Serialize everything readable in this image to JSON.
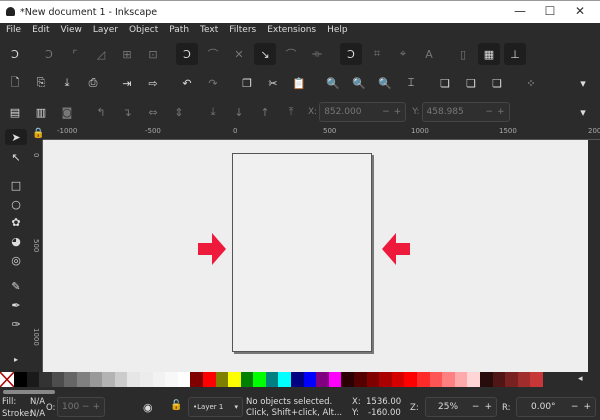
{
  "window": {
    "title": "*New document 1 - Inkscape",
    "minimize": "—",
    "maximize": "☐",
    "close": "✕"
  },
  "menu": [
    "File",
    "Edit",
    "View",
    "Layer",
    "Object",
    "Path",
    "Text",
    "Filters",
    "Extensions",
    "Help"
  ],
  "toolbar_snap": [
    "snap-toggle",
    "snap-bbox",
    "snap-bbox-edge",
    "snap-bbox-corner",
    "snap-bbox-midpoint",
    "snap-bbox-center",
    "snap-nodes",
    "snap-path",
    "snap-intersection",
    "snap-cusp",
    "snap-smooth",
    "snap-midpoint",
    "snap-others",
    "snap-center",
    "snap-rotation-center",
    "snap-text-baseline",
    "snap-page",
    "snap-grid",
    "snap-guide"
  ],
  "toolbar_commands": [
    "new",
    "open",
    "save",
    "print",
    "import",
    "export",
    "undo",
    "redo",
    "copy",
    "cut",
    "paste",
    "zoom-selection",
    "zoom-drawing",
    "zoom-page",
    "zoom-page-width",
    "duplicate",
    "clone",
    "unlink-clone",
    "select-group"
  ],
  "toolbar_select": {
    "x_label": "X:",
    "x_value": "852.000",
    "y_label": "Y:",
    "y_value": "458.985"
  },
  "ruler": {
    "h": [
      "-1000",
      "-500",
      "0",
      "500",
      "1000",
      "1500",
      "200"
    ],
    "v": [
      "0",
      "500",
      "1000"
    ]
  },
  "palette": [
    "#000000",
    "#1a1a1a",
    "#333333",
    "#4d4d4d",
    "#666666",
    "#808080",
    "#999999",
    "#b3b3b3",
    "#cccccc",
    "#e6e6e6",
    "#ececec",
    "#f2f2f2",
    "#f8f8f8",
    "#ffffff",
    "#800000",
    "#ff0000",
    "#808000",
    "#ffff00",
    "#008000",
    "#00ff00",
    "#008080",
    "#00ffff",
    "#000080",
    "#0000ff",
    "#800080",
    "#ff00ff",
    "#2b0000",
    "#550000",
    "#800000",
    "#aa0000",
    "#d40000",
    "#ff0000",
    "#ff2a2a",
    "#ff5555",
    "#ff8080",
    "#ffaaaa",
    "#ffd5d5",
    "#280b0b",
    "#501616",
    "#782121",
    "#a02c2c",
    "#c83737"
  ],
  "accent": "#ee1a3c",
  "status": {
    "fill_label": "Fill:",
    "fill_value": "N/A",
    "stroke_label": "Stroke:",
    "stroke_value": "N/A",
    "opacity_label": "O:",
    "opacity_value": "100",
    "layer": "•Layer 1",
    "message_1": "No objects selected.",
    "message_2": "Click, Shift+click, Alt...",
    "x_label": "X:",
    "x_value": "1536.00",
    "y_label": "Y:",
    "y_value": "-160.00",
    "zoom_label": "Z:",
    "zoom_value": "25%",
    "rotation_label": "R:",
    "rotation_value": "0.00°",
    "minus": "−",
    "plus": "+"
  }
}
